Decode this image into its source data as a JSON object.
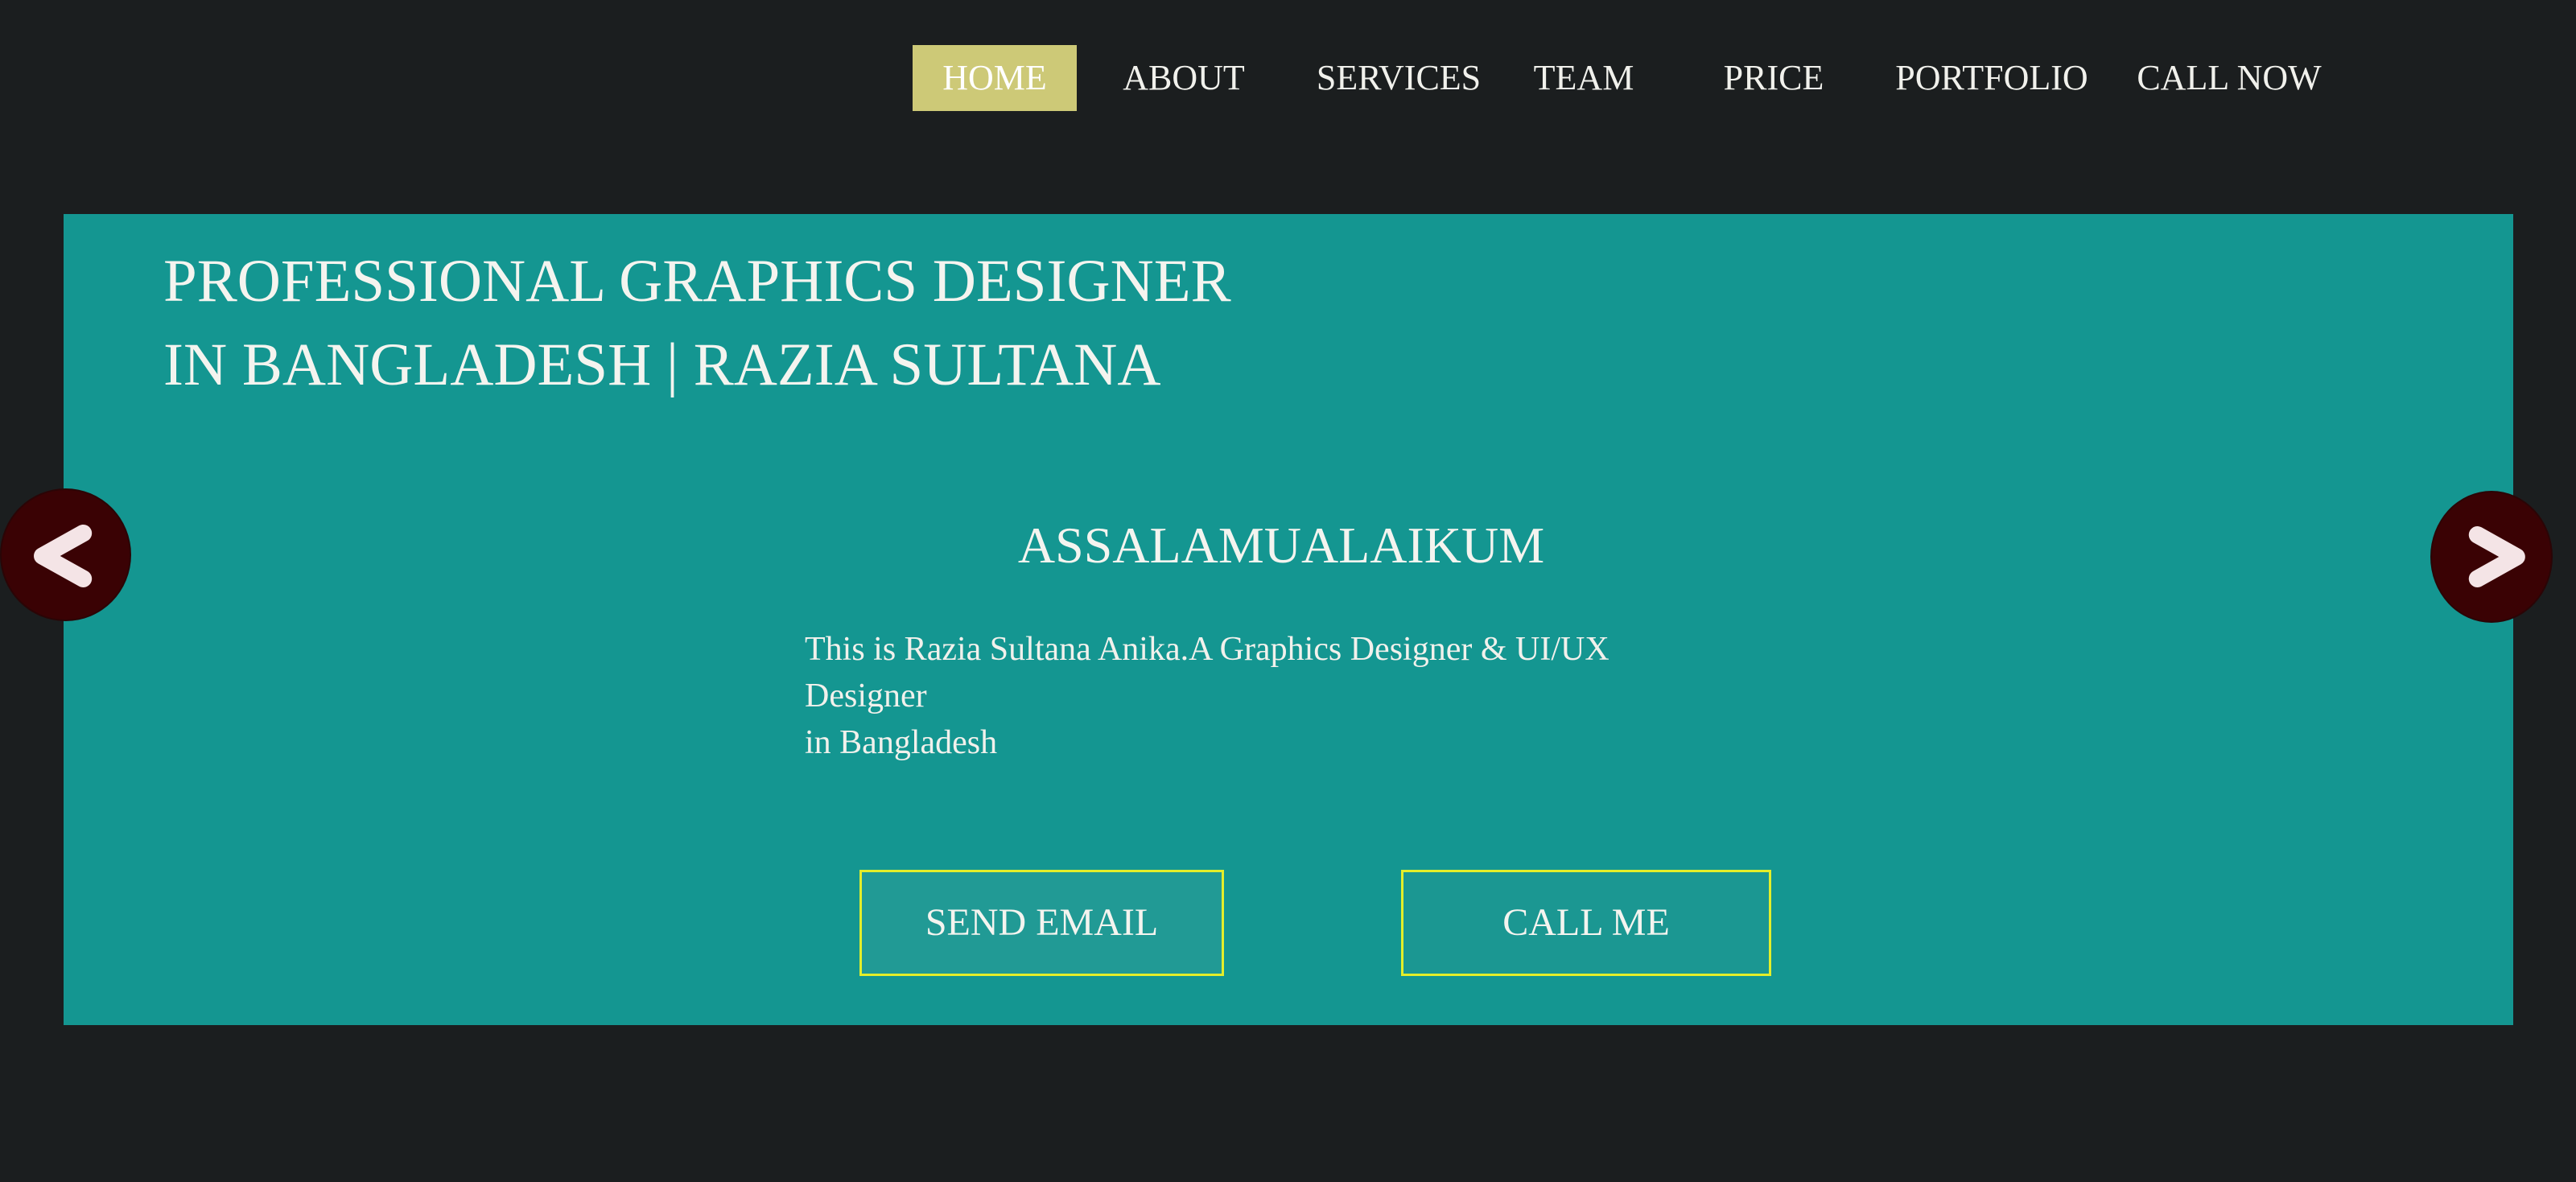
{
  "nav": {
    "items": [
      {
        "label": "HOME",
        "active": true
      },
      {
        "label": "ABOUT",
        "active": false
      },
      {
        "label": "SERVICES",
        "active": false
      },
      {
        "label": "TEAM",
        "active": false
      },
      {
        "label": "PRICE",
        "active": false
      },
      {
        "label": "PORTFOLIO",
        "active": false
      },
      {
        "label": "CALL NOW",
        "active": false
      }
    ]
  },
  "hero": {
    "title_line1": "PROFESSIONAL GRAPHICS DESIGNER",
    "title_line2": "IN BANGLADESH | RAZIA SULTANA",
    "greeting": "ASSALAMUALAIKUM",
    "intro_line1": "This is Razia Sultana Anika.A Graphics Designer & UI/UX Designer",
    "intro_line2": "in Bangladesh",
    "send_email_label": "SEND EMAIL",
    "call_me_label": "CALL ME"
  },
  "carousel": {
    "prev_icon": "chevron-left-icon",
    "next_icon": "chevron-right-icon"
  },
  "colors": {
    "page_background": "#1b1e1f",
    "hero_background": "#149691",
    "nav_active_background": "#cdc977",
    "button_border": "#e3ee2a",
    "arrow_background": "#3a0204"
  }
}
